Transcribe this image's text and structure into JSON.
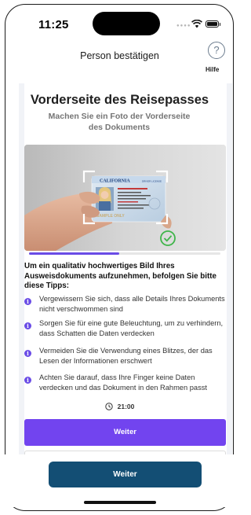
{
  "status_bar": {
    "time": "11:25",
    "signal_icon": "signal-dots-icon",
    "wifi_icon": "wifi-icon",
    "battery_icon": "battery-icon"
  },
  "header": {
    "title": "Person bestätigen",
    "help_icon": "question-circle-icon",
    "help_label": "Hilfe"
  },
  "document": {
    "title": "Vorderseite des Reisepasses",
    "subtitle": "Machen Sie ein Foto der Vorderseite des Dokuments",
    "image": {
      "card_state": "CALIFORNIA",
      "card_sub": "DRIVER LICENSE",
      "watermark": "SAMPLE ONLY",
      "check_icon": "check-circle-icon"
    },
    "progress": 0.47
  },
  "tips": {
    "intro": "Um ein qualitativ hochwertiges Bild Ihres Ausweisdokuments aufzunehmen, befolgen Sie bitte diese Tipps:",
    "icon": "info-icon",
    "items": [
      "Vergewissern Sie sich, dass alle Details Ihres Dokuments nicht verschwommen sind",
      "Sorgen Sie für eine gute Beleuchtung, um zu verhindern, dass Schatten die Daten verdecken",
      "Vermeiden Sie die Verwendung eines Blitzes, der das Lesen der Informationen erschwert",
      "Achten Sie darauf, dass Ihre Finger keine Daten verdecken und das Dokument in den Rahmen passt"
    ]
  },
  "timer": {
    "icon": "clock-icon",
    "value": "21:00"
  },
  "buttons": {
    "primary": "Weiter",
    "bottom": "Weiter"
  },
  "colors": {
    "accent": "#7244ef",
    "bottom_button": "#134e74",
    "check": "#3fb54a"
  }
}
